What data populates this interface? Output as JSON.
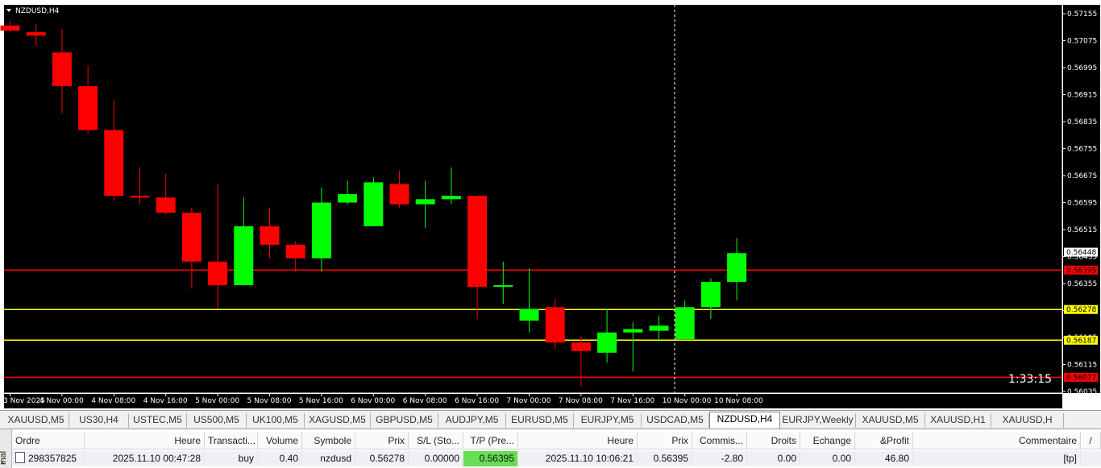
{
  "chart": {
    "symbol_label": "NZDUSD,H4",
    "countdown": "1:33:15",
    "price_labels": [
      "0.57155",
      "0.57075",
      "0.56995",
      "0.56915",
      "0.56835",
      "0.56755",
      "0.56675",
      "0.56595",
      "0.56515",
      "0.56435",
      "0.56355",
      "0.56275",
      "0.56195",
      "0.56115",
      "0.56035"
    ],
    "time_labels": [
      "3 Nov 2025",
      "4 Nov 00:00",
      "4 Nov 08:00",
      "4 Nov 16:00",
      "5 Nov 00:00",
      "5 Nov 08:00",
      "5 Nov 16:00",
      "6 Nov 00:00",
      "6 Nov 08:00",
      "6 Nov 16:00",
      "7 Nov 00:00",
      "7 Nov 08:00",
      "7 Nov 16:00",
      "10 Nov 00:00",
      "10 Nov 08:00"
    ],
    "current_price": "0.56448",
    "levels": [
      {
        "price": 0.56395,
        "label": "0.56395",
        "color": "#ff0000"
      },
      {
        "price": 0.56278,
        "label": "0.56278",
        "color": "#ffff00"
      },
      {
        "price": 0.56187,
        "label": "0.56187",
        "color": "#ffff00"
      },
      {
        "price": 0.56077,
        "label": "0.56077",
        "color": "#ff0000"
      }
    ],
    "colors": {
      "bull": "#00ff00",
      "bear": "#ff0000",
      "bg": "#000000",
      "wick": "#ffffff"
    },
    "candles": [
      {
        "o": 0.5712,
        "h": 0.57135,
        "l": 0.571,
        "c": 0.57105
      },
      {
        "o": 0.571,
        "h": 0.57125,
        "l": 0.5706,
        "c": 0.5709
      },
      {
        "o": 0.5704,
        "h": 0.5711,
        "l": 0.5686,
        "c": 0.5694
      },
      {
        "o": 0.5694,
        "h": 0.57,
        "l": 0.568,
        "c": 0.5681
      },
      {
        "o": 0.5681,
        "h": 0.569,
        "l": 0.566,
        "c": 0.56615
      },
      {
        "o": 0.56615,
        "h": 0.567,
        "l": 0.5659,
        "c": 0.5661
      },
      {
        "o": 0.5661,
        "h": 0.5668,
        "l": 0.5656,
        "c": 0.56565
      },
      {
        "o": 0.56565,
        "h": 0.5658,
        "l": 0.5634,
        "c": 0.5642
      },
      {
        "o": 0.5642,
        "h": 0.5665,
        "l": 0.5628,
        "c": 0.5635
      },
      {
        "o": 0.5635,
        "h": 0.5661,
        "l": 0.5635,
        "c": 0.56525
      },
      {
        "o": 0.56525,
        "h": 0.5658,
        "l": 0.5643,
        "c": 0.5647
      },
      {
        "o": 0.5647,
        "h": 0.5648,
        "l": 0.5639,
        "c": 0.5643
      },
      {
        "o": 0.5643,
        "h": 0.5664,
        "l": 0.5639,
        "c": 0.56595
      },
      {
        "o": 0.56595,
        "h": 0.5666,
        "l": 0.5659,
        "c": 0.5662
      },
      {
        "o": 0.56525,
        "h": 0.5667,
        "l": 0.56525,
        "c": 0.56655
      },
      {
        "o": 0.5665,
        "h": 0.5669,
        "l": 0.5658,
        "c": 0.5659
      },
      {
        "o": 0.5659,
        "h": 0.5666,
        "l": 0.5652,
        "c": 0.56605
      },
      {
        "o": 0.56605,
        "h": 0.567,
        "l": 0.5659,
        "c": 0.56615
      },
      {
        "o": 0.56615,
        "h": 0.56615,
        "l": 0.5625,
        "c": 0.56345
      },
      {
        "o": 0.56345,
        "h": 0.5642,
        "l": 0.56295,
        "c": 0.5635
      },
      {
        "o": 0.56245,
        "h": 0.564,
        "l": 0.5621,
        "c": 0.5628
      },
      {
        "o": 0.56285,
        "h": 0.5631,
        "l": 0.5616,
        "c": 0.5618
      },
      {
        "o": 0.5618,
        "h": 0.562,
        "l": 0.5605,
        "c": 0.56155
      },
      {
        "o": 0.5615,
        "h": 0.5628,
        "l": 0.5612,
        "c": 0.5621
      },
      {
        "o": 0.5621,
        "h": 0.5624,
        "l": 0.56095,
        "c": 0.5622
      },
      {
        "o": 0.56215,
        "h": 0.5626,
        "l": 0.5619,
        "c": 0.5623
      },
      {
        "o": 0.5619,
        "h": 0.56305,
        "l": 0.5619,
        "c": 0.56285
      },
      {
        "o": 0.56285,
        "h": 0.5637,
        "l": 0.5625,
        "c": 0.5636
      },
      {
        "o": 0.5636,
        "h": 0.5649,
        "l": 0.56305,
        "c": 0.56445
      }
    ]
  },
  "tabs": [
    "XAUUSD,M5",
    "US30,H4",
    "USTEC,M5",
    "US500,M5",
    "UK100,M5",
    "XAGUSD,M5",
    "GBPUSD,M5",
    "AUDJPY,M5",
    "EURUSD,M5",
    "EURJPY,M5",
    "USDCAD,M5",
    "NZDUSD,H4",
    "EURJPY,Weekly",
    "XAUUSD,M5",
    "XAUUSD,H1",
    "XAUUSD,H"
  ],
  "active_tab": "NZDUSD,H4",
  "terminal": {
    "side_label": "inal",
    "close_glyph": "×",
    "headers": [
      "Ordre",
      "Heure",
      "Transacti...",
      "Volume",
      "Symbole",
      "Prix",
      "S/L (Sto...",
      "T/P (Pre...",
      "Heure",
      "Prix",
      "Commis...",
      "Droits",
      "Echange",
      "&Profit",
      "Commentaire"
    ],
    "sort_glyph": "/",
    "row": {
      "ordre": "298357825",
      "heure": "2025.11.10 00:47:28",
      "transaction": "buy",
      "volume": "0.40",
      "symbole": "nzdusd",
      "prix": "0.56278",
      "sl": "0.00000",
      "tp": "0.56395",
      "heure2": "2025.11.10 10:06:21",
      "prix2": "0.56395",
      "commission": "-2.80",
      "droits": "0.00",
      "echange": "0.00",
      "profit": "46.80",
      "commentaire": "[tp]"
    },
    "tp_highlight_color": "#66dd55"
  }
}
